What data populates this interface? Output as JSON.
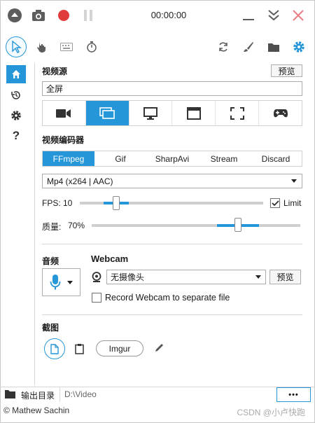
{
  "titlebar": {
    "timer": "00:00:00",
    "icons": [
      "minimize-circle-icon",
      "camera-icon",
      "record-icon",
      "pause-icon",
      "minimize-icon",
      "collapse-icon",
      "close-icon"
    ]
  },
  "tools": [
    "cursor-icon",
    "hand-icon",
    "keyboard-icon",
    "stopwatch-icon",
    "refresh-icon",
    "brush-icon",
    "folder-icon",
    "gear-icon"
  ],
  "sidebar": [
    "home-icon",
    "history-icon",
    "settings-icon",
    "help-icon"
  ],
  "sidebar_help_glyph": "?",
  "video_source": {
    "label": "视频源",
    "preview_label": "预览",
    "value": "全屏",
    "sources": [
      "camera-icon",
      "screen-icon",
      "monitor-icon",
      "window-icon",
      "region-icon",
      "gamepad-icon"
    ],
    "active_index": 1
  },
  "encoder": {
    "label": "视频编码器",
    "tabs": [
      "FFmpeg",
      "Gif",
      "SharpAvi",
      "Stream",
      "Discard"
    ],
    "active_index": 0,
    "codec": "Mp4 (x264 | AAC)",
    "fps_label": "FPS:",
    "fps_value": "10",
    "fps_fraction": 0.2,
    "limit_label": "Limit",
    "limit_checked": true,
    "quality_label": "质量:",
    "quality_value": "70%",
    "quality_fraction": 0.7
  },
  "audio": {
    "label": "音频"
  },
  "webcam": {
    "label": "Webcam",
    "selected": "无摄像头",
    "preview_label": "预览",
    "separate_label": "Record Webcam to separate file",
    "separate_checked": false
  },
  "screenshot": {
    "label": "截图",
    "imgur_label": "Imgur"
  },
  "output": {
    "label": "输出目录",
    "path": "D:\\Video",
    "more_label": "•••"
  },
  "status": {
    "author": "© Mathew Sachin",
    "watermark": "CSDN @小卢快跑"
  },
  "colors": {
    "accent": "#2596d8",
    "record": "#e03c3c",
    "close": "#e87e86"
  }
}
